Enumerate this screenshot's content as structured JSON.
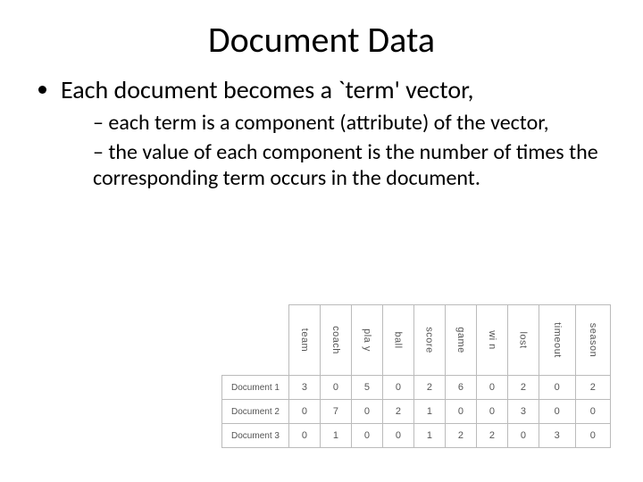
{
  "title": "Document Data",
  "bullets": {
    "l1_0": "Each document becomes a `term' vector,",
    "l2_0": "each term is a component (attribute) of the vector,",
    "l2_1": "the value of each component is the number of times the corresponding term occurs in the document."
  },
  "chart_data": {
    "type": "table",
    "columns": [
      "team",
      "coach",
      "pla y",
      "ball",
      "score",
      "game",
      "wi n",
      "lost",
      "timeout",
      "season"
    ],
    "rows": [
      {
        "name": "Document 1",
        "values": [
          3,
          0,
          5,
          0,
          2,
          6,
          0,
          2,
          0,
          2
        ]
      },
      {
        "name": "Document 2",
        "values": [
          0,
          7,
          0,
          2,
          1,
          0,
          0,
          3,
          0,
          0
        ]
      },
      {
        "name": "Document 3",
        "values": [
          0,
          1,
          0,
          0,
          1,
          2,
          2,
          0,
          3,
          0
        ]
      }
    ]
  }
}
